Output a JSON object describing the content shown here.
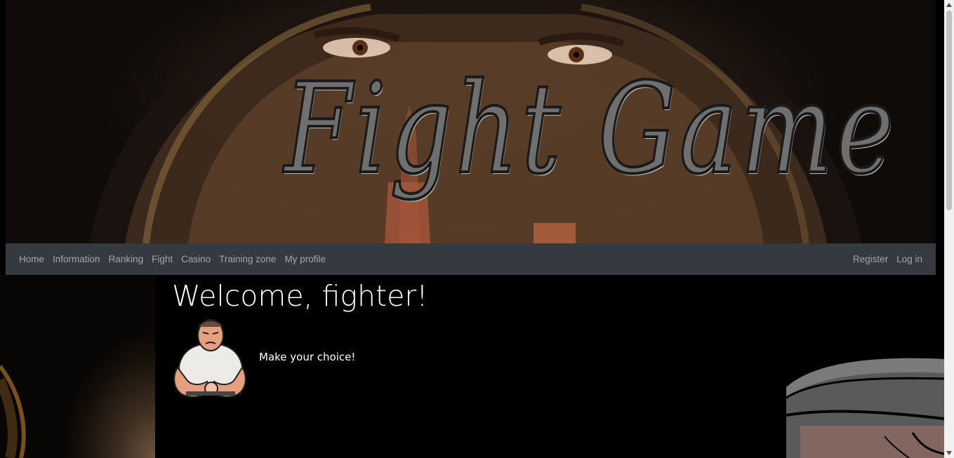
{
  "banner": {
    "title": "Fight Game"
  },
  "nav": {
    "left": [
      {
        "label": "Home"
      },
      {
        "label": "Information"
      },
      {
        "label": "Ranking"
      },
      {
        "label": "Fight"
      },
      {
        "label": "Casino"
      },
      {
        "label": "Training zone"
      },
      {
        "label": "My profile"
      }
    ],
    "right": [
      {
        "label": "Register"
      },
      {
        "label": "Log in"
      }
    ]
  },
  "main": {
    "heading": "Welcome, fighter!",
    "tagline": "Make your choice!"
  },
  "colors": {
    "navbar_bg": "#343a40",
    "nav_link": "#a3a6a9",
    "page_bg": "#000000",
    "text": "#ffffff"
  },
  "icons": {
    "fighter_avatar": "cartoon-fighter-icon",
    "scroll_up": "triangle-up-icon",
    "scroll_down": "triangle-down-icon"
  }
}
